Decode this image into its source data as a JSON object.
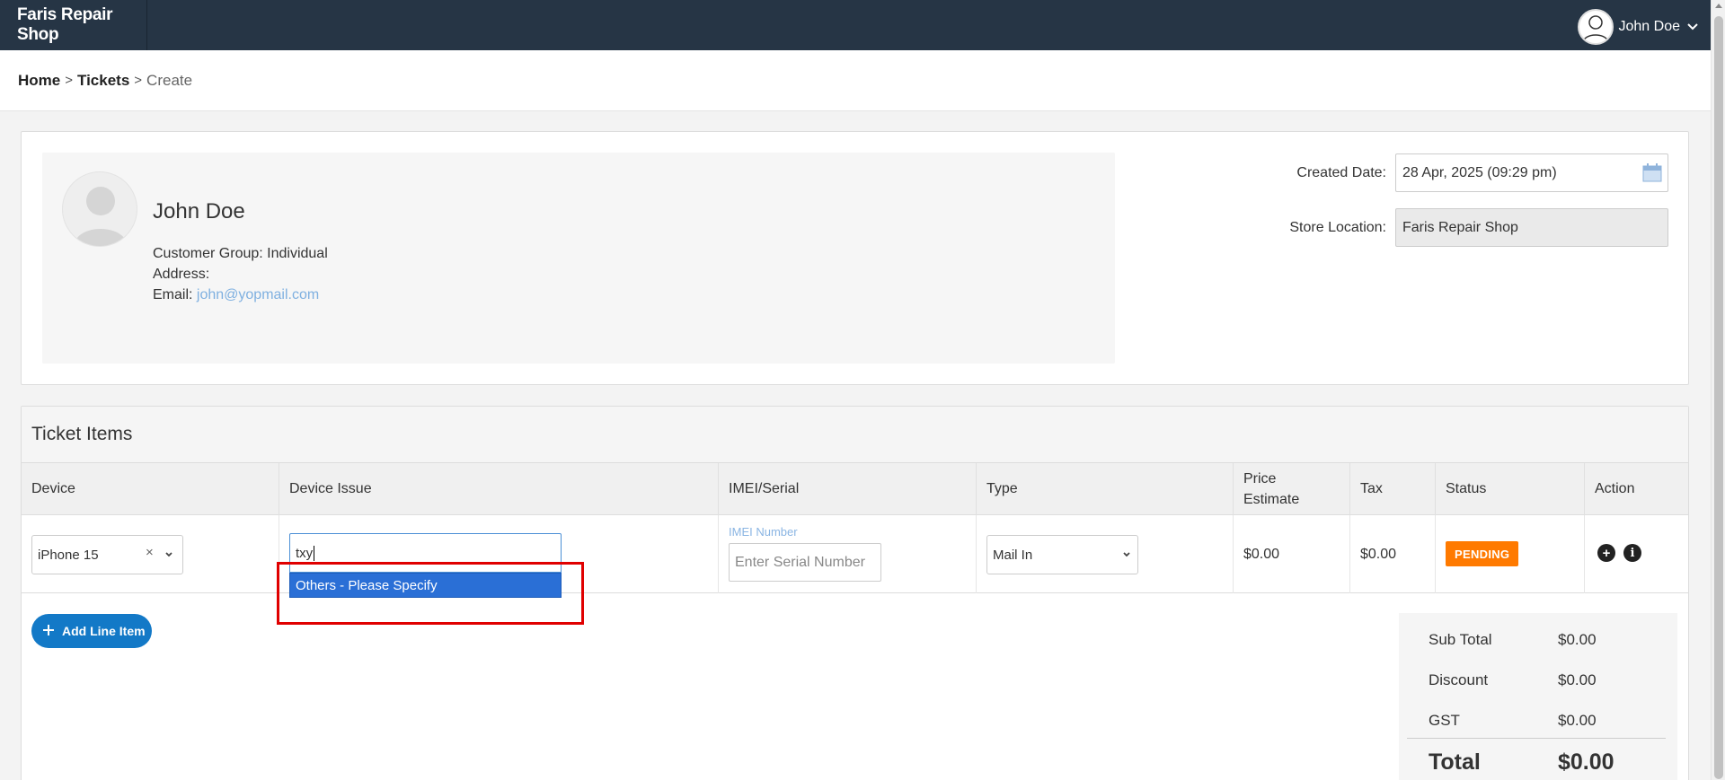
{
  "header": {
    "brand": "Faris Repair Shop",
    "user_name": "John Doe"
  },
  "breadcrumb": {
    "home": "Home",
    "tickets": "Tickets",
    "current": "Create"
  },
  "customer": {
    "name": "John Doe",
    "group_label": "Customer Group: Individual",
    "address_label": "Address:",
    "email_label": "Email:",
    "email": "john@yopmail.com"
  },
  "meta": {
    "created_label": "Created Date:",
    "created_value": "28 Apr, 2025 (09:29 pm)",
    "store_label": "Store Location:",
    "store_value": "Faris Repair Shop"
  },
  "items": {
    "title": "Ticket Items",
    "columns": [
      "Device",
      "Device Issue",
      "IMEI/Serial",
      "Type",
      "Price Estimate",
      "Tax",
      "Status",
      "Action"
    ],
    "row": {
      "device": "iPhone 15",
      "clear_glyph": "×",
      "issue_typed": "txy",
      "issue_option": "Others - Please Specify",
      "imei_label": "IMEI Number",
      "imei_placeholder": "Enter Serial Number",
      "type": "Mail In",
      "price": "$0.00",
      "tax": "$0.00",
      "status": "PENDING",
      "status_color": "#ff7a00"
    },
    "add_button": "Add Line Item"
  },
  "totals": {
    "sub_total_label": "Sub Total",
    "sub_total": "$0.00",
    "discount_label": "Discount",
    "discount": "$0.00",
    "gst_label": "GST",
    "gst": "$0.00",
    "total_label": "Total",
    "total": "$0.00"
  },
  "colors": {
    "topbar": "#263545",
    "accent": "#1379c7",
    "highlight": "#e00000"
  }
}
